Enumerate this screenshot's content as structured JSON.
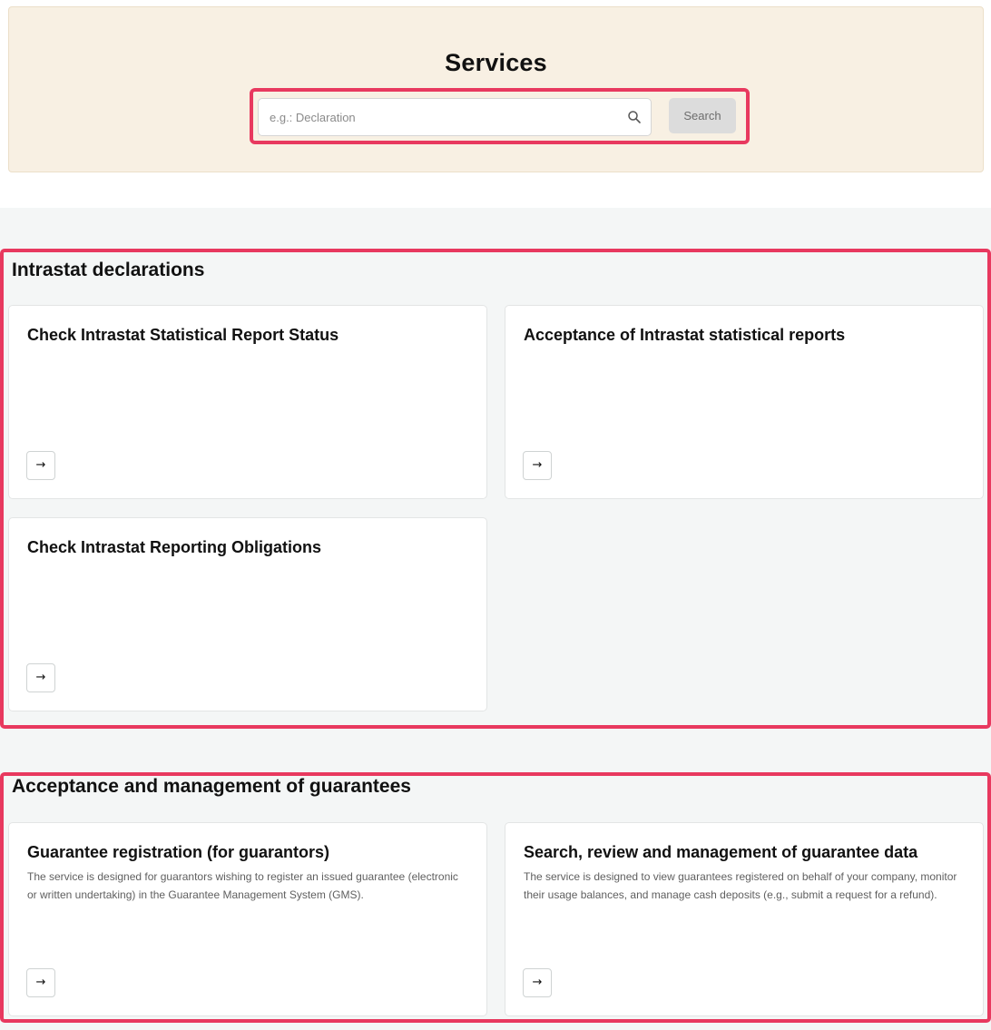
{
  "header": {
    "title": "Services",
    "search": {
      "placeholder": "e.g.: Declaration",
      "value": "",
      "button_label": "Search",
      "icon": "search-icon"
    }
  },
  "sections": [
    {
      "title": "Intrastat declarations",
      "cards": [
        {
          "title": "Check Intrastat Statistical Report Status",
          "description": "",
          "arrow": "→"
        },
        {
          "title": "Acceptance of Intrastat statistical reports",
          "description": "",
          "arrow": "→"
        },
        {
          "title": "Check Intrastat Reporting Obligations",
          "description": "",
          "arrow": "→"
        }
      ]
    },
    {
      "title": "Acceptance and management of guarantees",
      "cards": [
        {
          "title": "Guarantee registration (for guarantors)",
          "description": "The service is designed for guarantors wishing to register an issued guarantee (electronic or written undertaking) in the Guarantee Management System (GMS).",
          "arrow": "→"
        },
        {
          "title": "Search, review and management of guarantee data",
          "description": "The service is designed to view guarantees registered on behalf of your company, monitor their usage balances, and manage cash deposits (e.g., submit a request for a refund).",
          "arrow": "→"
        }
      ]
    }
  ],
  "colors": {
    "hero_bg": "#f8f0e3",
    "highlight_border": "#e8395f",
    "page_bg": "#f4f6f6",
    "card_bg": "#ffffff"
  }
}
